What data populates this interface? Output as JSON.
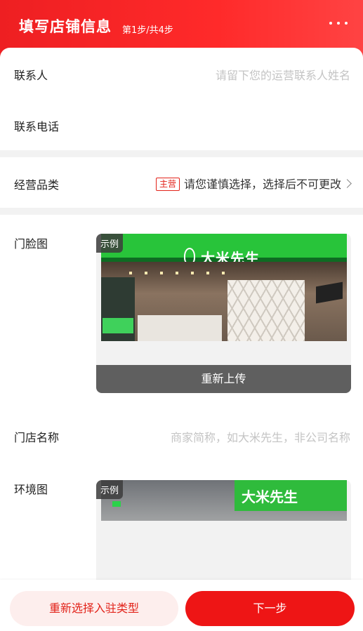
{
  "header": {
    "title": "填写店铺信息",
    "step": "第1步/共4步",
    "more_icon": "more-dots-icon"
  },
  "form": {
    "contact": {
      "label": "联系人",
      "placeholder": "请留下您的运营联系人姓名"
    },
    "phone": {
      "label": "联系电话",
      "value": ""
    },
    "category": {
      "label": "经营品类",
      "tag": "主营",
      "hint": "请您谨慎选择，选择后不可更改"
    },
    "storefront": {
      "label": "门脸图",
      "badge": "示例",
      "sign_text": "大米先生",
      "reupload": "重新上传"
    },
    "store_name": {
      "label": "门店名称",
      "placeholder": "商家简称，如大米先生，非公司名称"
    },
    "environment": {
      "label": "环境图",
      "badge": "示例",
      "sign_text": "大米先生"
    }
  },
  "footer": {
    "reselect": "重新选择入驻类型",
    "next": "下一步"
  },
  "colors": {
    "brand_red": "#ee1515",
    "tag_red": "#e2231a",
    "reselect_bg": "#fdeeed"
  }
}
